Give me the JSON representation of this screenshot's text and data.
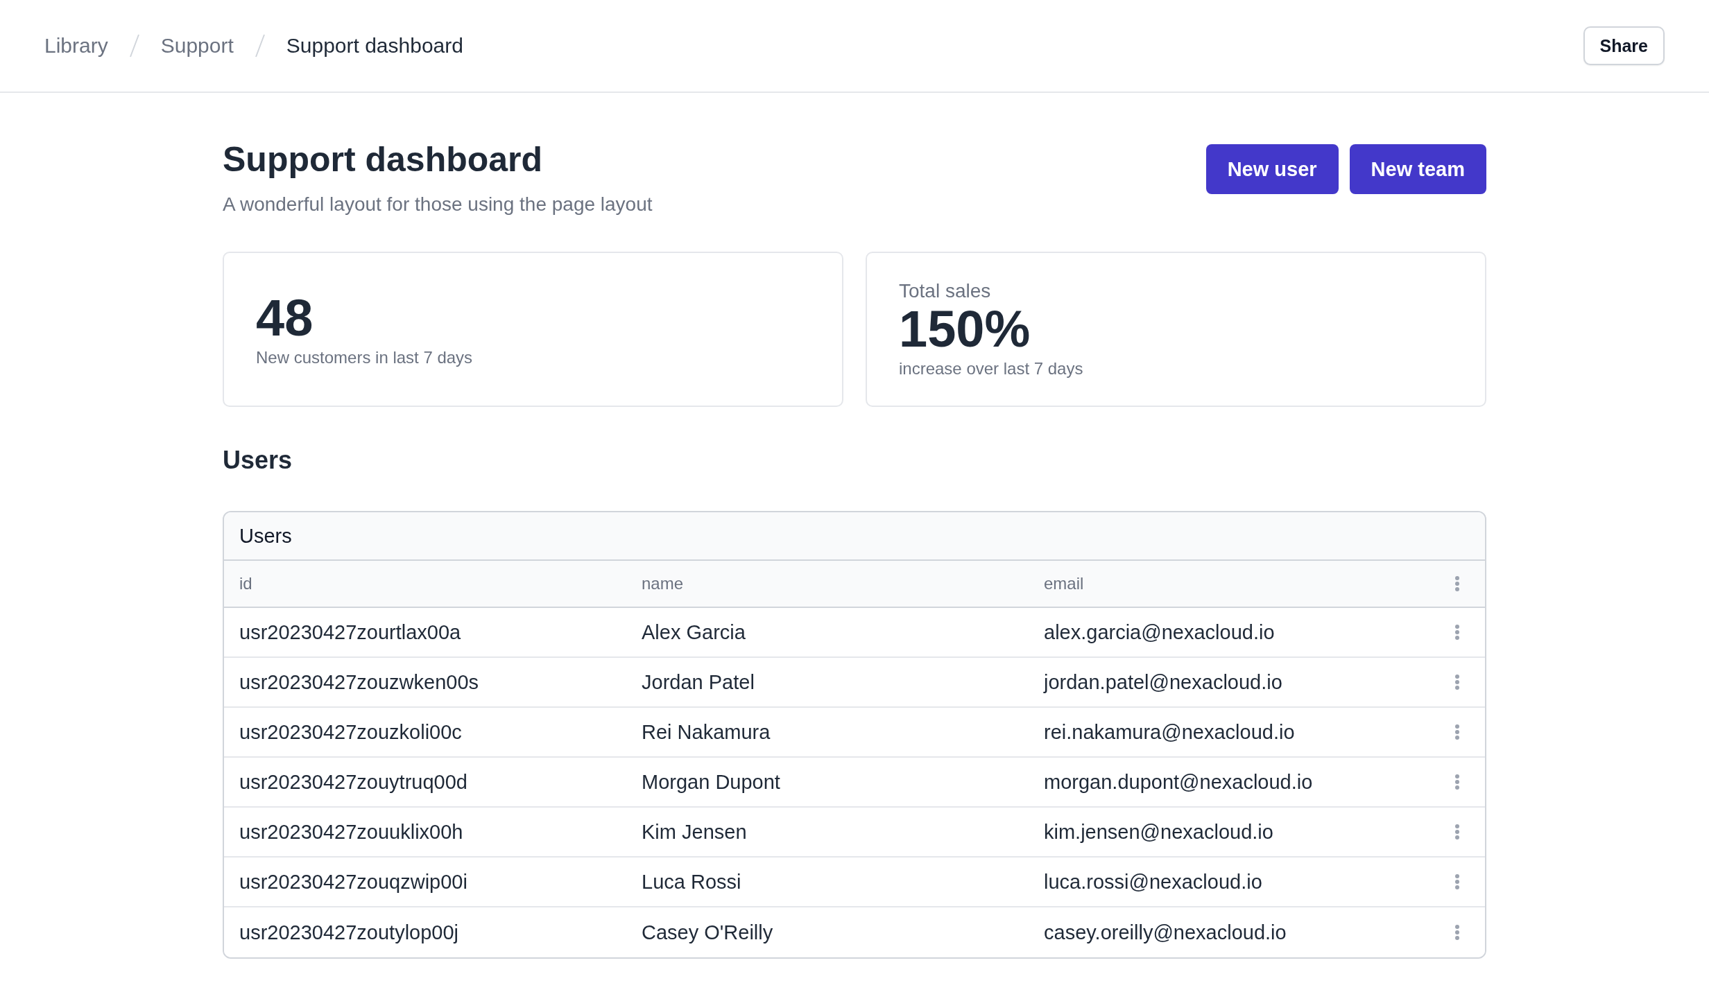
{
  "breadcrumbs": [
    {
      "label": "Library",
      "current": false
    },
    {
      "label": "Support",
      "current": false
    },
    {
      "label": "Support dashboard",
      "current": true
    }
  ],
  "share_button": "Share",
  "page": {
    "title": "Support dashboard",
    "subtitle": "A wonderful layout for those using the page layout"
  },
  "actions": [
    "New user",
    "New team"
  ],
  "stats": [
    {
      "value": "48",
      "caption": "New customers in last 7 days"
    },
    {
      "label": "Total sales",
      "value": "150%",
      "caption": "increase over last 7 days"
    }
  ],
  "section_title": "Users",
  "table": {
    "title": "Users",
    "columns": [
      "id",
      "name",
      "email"
    ],
    "rows": [
      [
        "usr20230427zourtlax00a",
        "Alex Garcia",
        "alex.garcia@nexacloud.io"
      ],
      [
        "usr20230427zouzwken00s",
        "Jordan Patel",
        "jordan.patel@nexacloud.io"
      ],
      [
        "usr20230427zouzkoli00c",
        "Rei Nakamura",
        "rei.nakamura@nexacloud.io"
      ],
      [
        "usr20230427zouytruq00d",
        "Morgan Dupont",
        "morgan.dupont@nexacloud.io"
      ],
      [
        "usr20230427zouuklix00h",
        "Kim Jensen",
        "kim.jensen@nexacloud.io"
      ],
      [
        "usr20230427zouqzwip00i",
        "Luca Rossi",
        "luca.rossi@nexacloud.io"
      ],
      [
        "usr20230427zoutylop00j",
        "Casey O'Reilly",
        "casey.oreilly@nexacloud.io"
      ]
    ]
  }
}
